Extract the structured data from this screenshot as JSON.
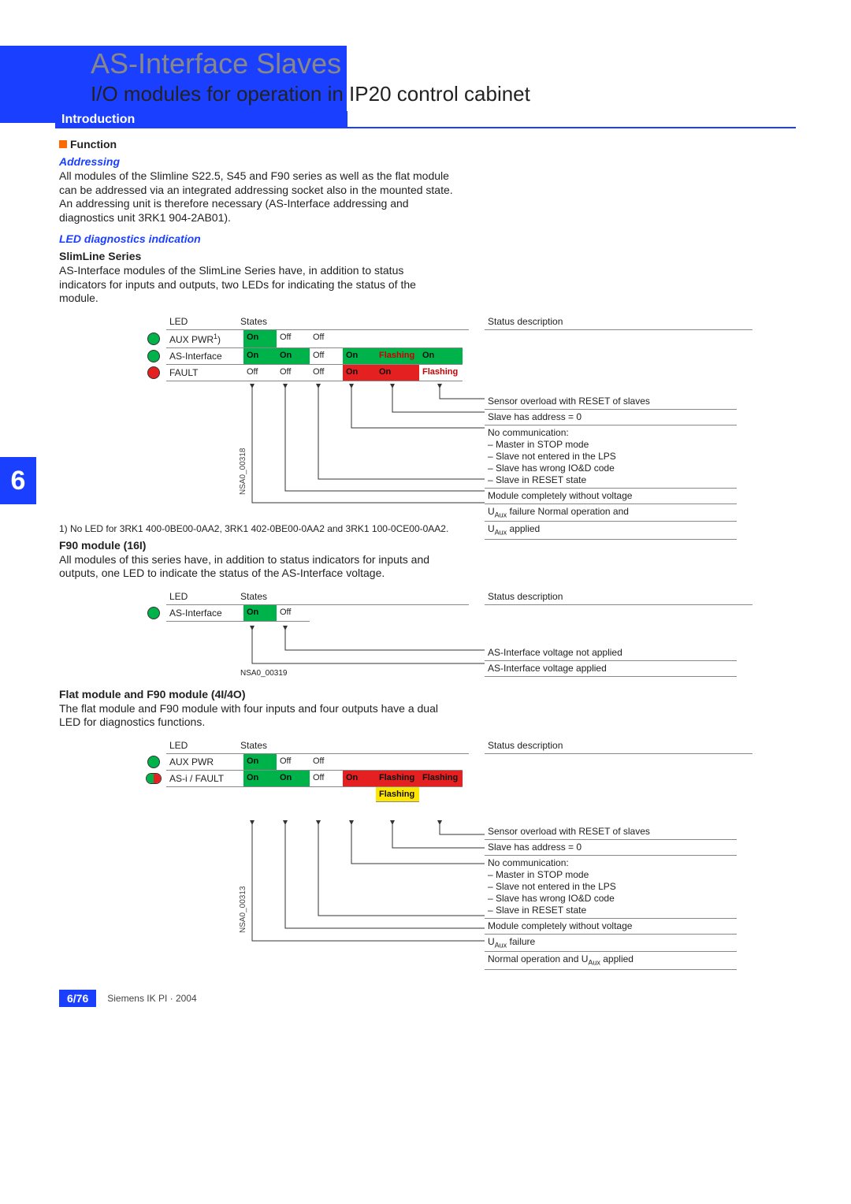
{
  "header": {
    "title": "AS-Interface Slaves",
    "subtitle": "I/O modules for operation in IP20 control cabinet",
    "intro_label": "Introduction"
  },
  "function": {
    "heading": "Function",
    "addressing_heading": "Addressing",
    "addressing_text": "All modules of the Slimline S22.5, S45 and F90 series as well as the flat module can be addressed via an integrated addressing socket also in the mounted state. An addressing unit is therefore necessary (AS-Interface addressing and diagnostics unit 3RK1 904-2AB01).",
    "led_heading": "LED diagnostics indication",
    "slimline_heading": "SlimLine Series",
    "slimline_text": "AS-Interface modules of the SlimLine Series have, in addition to status indicators for inputs and outputs, two LEDs for indicating the status of the module.",
    "footnote1": "1) No LED for 3RK1 400-0BE00-0AA2, 3RK1 402-0BE00-0AA2 and 3RK1 100-0CE00-0AA2.",
    "f90_16i_heading": "F90 module (16I)",
    "f90_16i_text": "All modules of this series have, in addition to status indicators for inputs and outputs, one LED to indicate the status of the AS-Interface voltage.",
    "flat_heading": "Flat module and F90 module (4I/4O)",
    "flat_text": "The flat module and F90 module with four inputs and four outputs have a dual LED for diagnostics functions."
  },
  "diagram_labels": {
    "led": "LED",
    "states": "States",
    "status_desc": "Status description",
    "aux_pwr1": "AUX PWR¹)",
    "aux_pwr": "AUX PWR",
    "as_interface": "AS-Interface",
    "fault": "FAULT",
    "asi_fault": "AS-i / FAULT",
    "on": "On",
    "off": "Off",
    "flashing": "Flashing"
  },
  "slimline_table": {
    "rows": [
      {
        "label": "AUX PWR¹)",
        "cells": [
          "On",
          "Off",
          "Off",
          "",
          "",
          ""
        ]
      },
      {
        "label": "AS-Interface",
        "cells": [
          "On",
          "On",
          "Off",
          "On",
          "Flashing",
          "On"
        ]
      },
      {
        "label": "FAULT",
        "cells": [
          "Off",
          "Off",
          "Off",
          "On",
          "On",
          "Flashing"
        ]
      }
    ],
    "status": [
      "Sensor overload with RESET of slaves",
      "Slave has address = 0",
      "No communication:\n– Master in STOP mode\n– Slave not entered in the LPS\n– Slave has wrong IO&D code\n– Slave in RESET state",
      "Module completely without voltage",
      "UAux failure Normal operation and",
      "UAux applied"
    ],
    "nsa": "NSA0_00318"
  },
  "f90_table": {
    "rows": [
      {
        "label": "AS-Interface",
        "cells": [
          "On",
          "Off"
        ]
      }
    ],
    "status": [
      "AS-Interface voltage not applied",
      "AS-Interface voltage applied"
    ],
    "nsa": "NSA0_00319"
  },
  "flat_table": {
    "rows": [
      {
        "label": "AUX PWR",
        "cells": [
          "On",
          "Off",
          "Off",
          "",
          "",
          ""
        ]
      },
      {
        "label": "AS-i / FAULT",
        "cells": [
          "On",
          "On",
          "Off",
          "On",
          "Flashing",
          "Flashing"
        ],
        "extra": "Flashing"
      }
    ],
    "status": [
      "Sensor overload with RESET of slaves",
      "Slave has address = 0",
      "No communication:\n– Master in STOP mode\n– Slave not entered in the LPS\n– Slave has wrong IO&D code\n– Slave in RESET state",
      "Module completely without voltage",
      "UAux failure",
      "Normal operation and UAux applied"
    ],
    "nsa": "NSA0_00313"
  },
  "side_num": "6",
  "footer": {
    "page": "6/76",
    "text": "Siemens IK PI · 2004"
  }
}
